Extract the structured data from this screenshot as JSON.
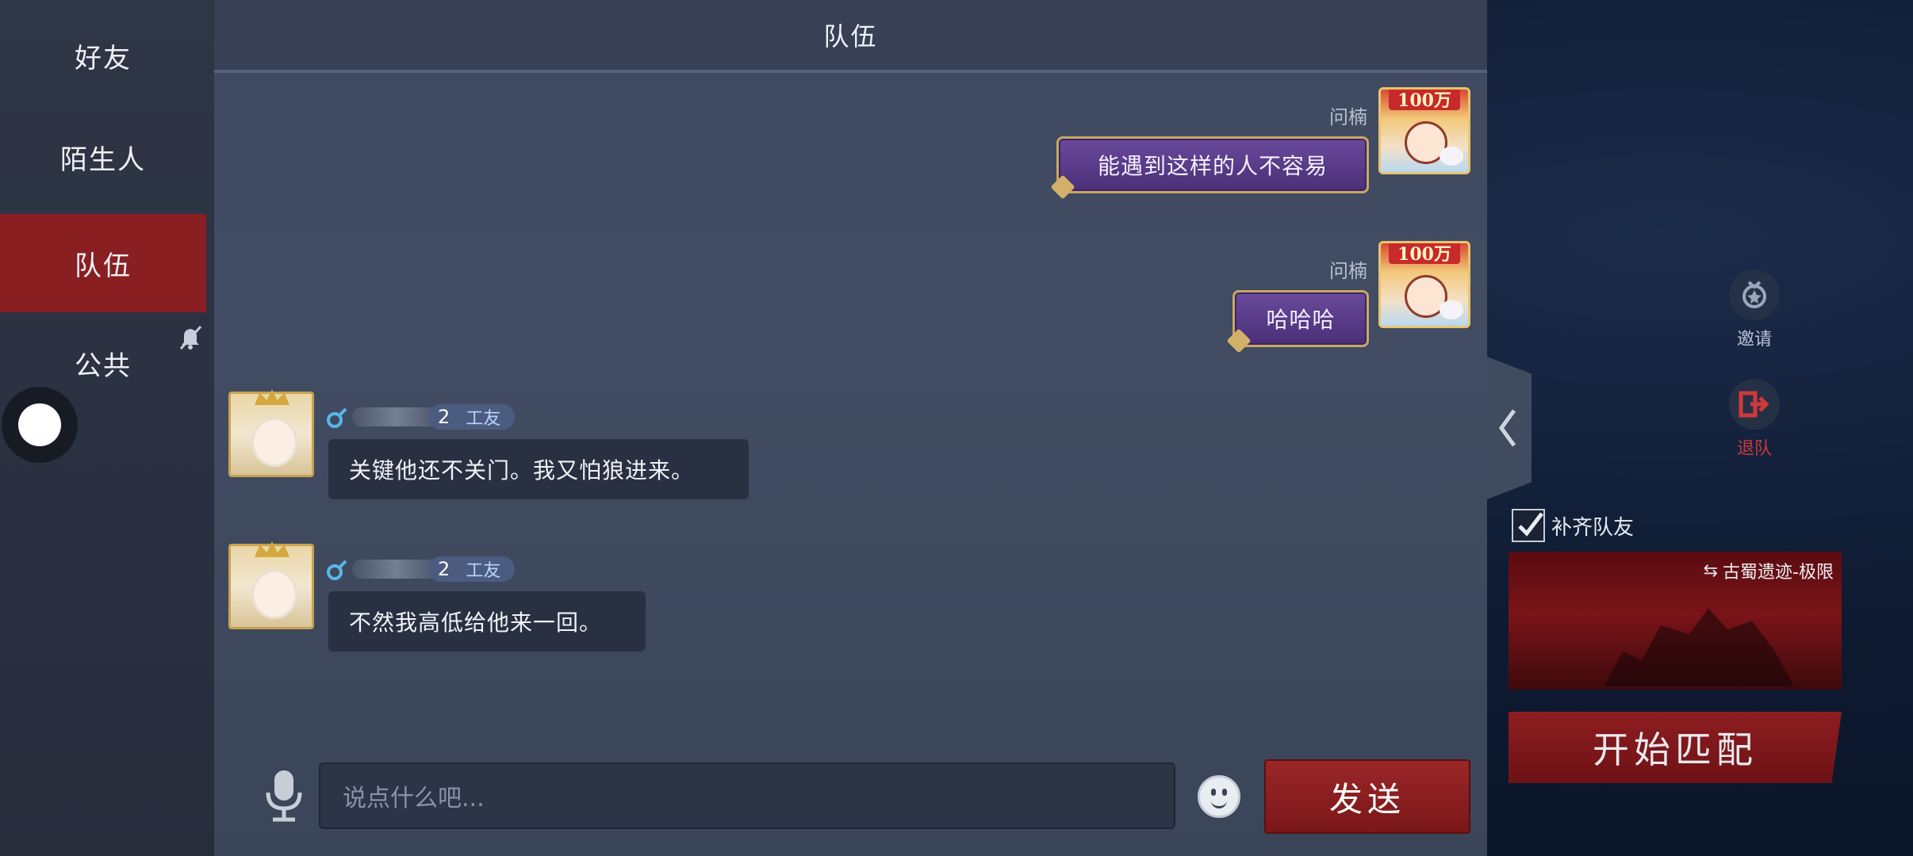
{
  "sidebar": {
    "items": [
      {
        "label": "好友"
      },
      {
        "label": "陌生人"
      },
      {
        "label": "队伍"
      },
      {
        "label": "公共"
      }
    ]
  },
  "chat": {
    "title": "队伍",
    "messages_self": [
      {
        "name": "问楠",
        "text": "能遇到这样的人不容易",
        "avatar_badge": "100万"
      },
      {
        "name": "问楠",
        "text": "哈哈哈",
        "avatar_badge": "100万"
      }
    ],
    "messages_other": [
      {
        "level": "2",
        "tag": "工友",
        "text": "关键他还不关门。我又怕狼进来。"
      },
      {
        "level": "2",
        "tag": "工友",
        "text": "不然我高低给他来一回。"
      }
    ]
  },
  "input": {
    "placeholder": "说点什么吧...",
    "send_label": "发送"
  },
  "game": {
    "invite_label": "邀请",
    "leave_label": "退队",
    "fill_team_label": "补齐队友",
    "fill_team_checked": true,
    "map_name": "古蜀遗迹-极限",
    "start_label": "开始匹配"
  },
  "colors": {
    "accent_red": "#8a1f22",
    "bubble_purple": "#4a2f78",
    "bubble_gold": "#c9a765",
    "tag_blue": "#b9d4ff"
  }
}
